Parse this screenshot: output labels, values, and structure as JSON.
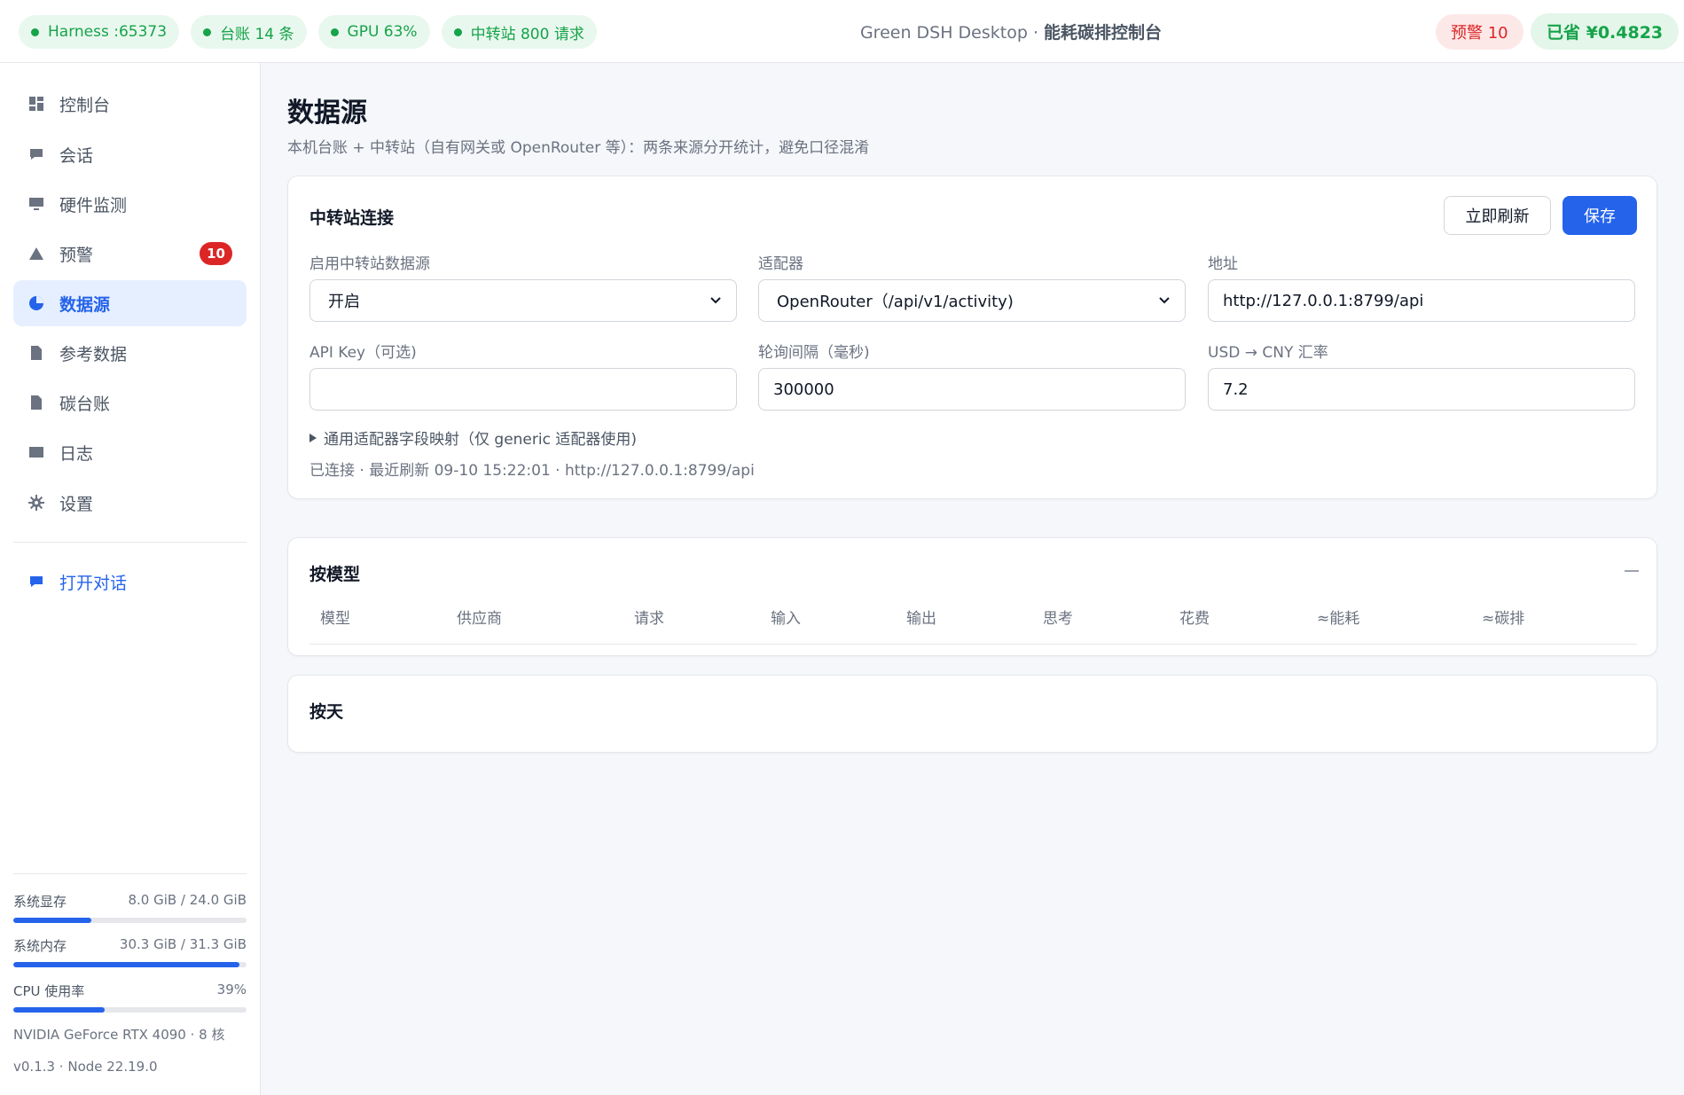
{
  "topbar": {
    "pills": [
      "Harness :65373",
      "台账 14 条",
      "GPU 63%",
      "中转站 800 请求"
    ],
    "title_prefix": "Green DSH Desktop · ",
    "title_bold": "能耗碳排控制台",
    "alert": "预警 10",
    "saved": "已省 ¥0.4823"
  },
  "sidebar": {
    "items": [
      {
        "label": "控制台",
        "icon": "dashboard-icon"
      },
      {
        "label": "会话",
        "icon": "chat-icon"
      },
      {
        "label": "硬件监测",
        "icon": "monitor-icon"
      },
      {
        "label": "预警",
        "icon": "warning-icon",
        "badge": "10"
      },
      {
        "label": "数据源",
        "icon": "pie-icon",
        "active": true
      },
      {
        "label": "参考数据",
        "icon": "document-icon"
      },
      {
        "label": "碳台账",
        "icon": "ledger-icon"
      },
      {
        "label": "日志",
        "icon": "log-icon"
      },
      {
        "label": "设置",
        "icon": "gear-icon"
      }
    ],
    "open_chat": "打开对话",
    "metrics": [
      {
        "label": "系统显存",
        "value": "8.0 GiB / 24.0 GiB",
        "fraction": 0.333
      },
      {
        "label": "系统内存",
        "value": "30.3 GiB / 31.3 GiB",
        "fraction": 0.968
      },
      {
        "label": "CPU 使用率",
        "value": "39%",
        "fraction": 0.39
      }
    ],
    "hardware": "NVIDIA GeForce RTX 4090 · 8 核",
    "version": "v0.1.3 · Node 22.19.0"
  },
  "page": {
    "title": "数据源",
    "subtitle": "本机台账 + 中转站（自有网关或 OpenRouter 等）：两条来源分开统计，避免口径混淆"
  },
  "relay": {
    "title": "中转站连接",
    "refresh_label": "立即刷新",
    "save_label": "保存",
    "enable_label": "启用中转站数据源",
    "enable_value": "开启",
    "adapter_label": "适配器",
    "adapter_value": "OpenRouter（/api/v1/activity)",
    "address_label": "地址",
    "address_value": "http://127.0.0.1:8799/api",
    "apikey_label": "API Key（可选)",
    "apikey_value": "",
    "interval_label": "轮询间隔（毫秒)",
    "interval_value": "300000",
    "rate_label": "USD → CNY 汇率",
    "rate_value": "7.2",
    "mapping_label": "通用适配器字段映射（仅 generic 适配器使用)",
    "status": "已连接 · 最近刷新 09-10 15:22:01 · http://127.0.0.1:8799/api"
  },
  "by_model": {
    "title": "按模型",
    "columns": [
      "模型",
      "供应商",
      "请求",
      "输入",
      "输出",
      "思考",
      "花费",
      "≈能耗",
      "≈碳排"
    ]
  },
  "by_day": {
    "title": "按天"
  },
  "colors": {
    "accent": "#2563eb",
    "success": "#16a34a",
    "danger": "#dc2626"
  }
}
